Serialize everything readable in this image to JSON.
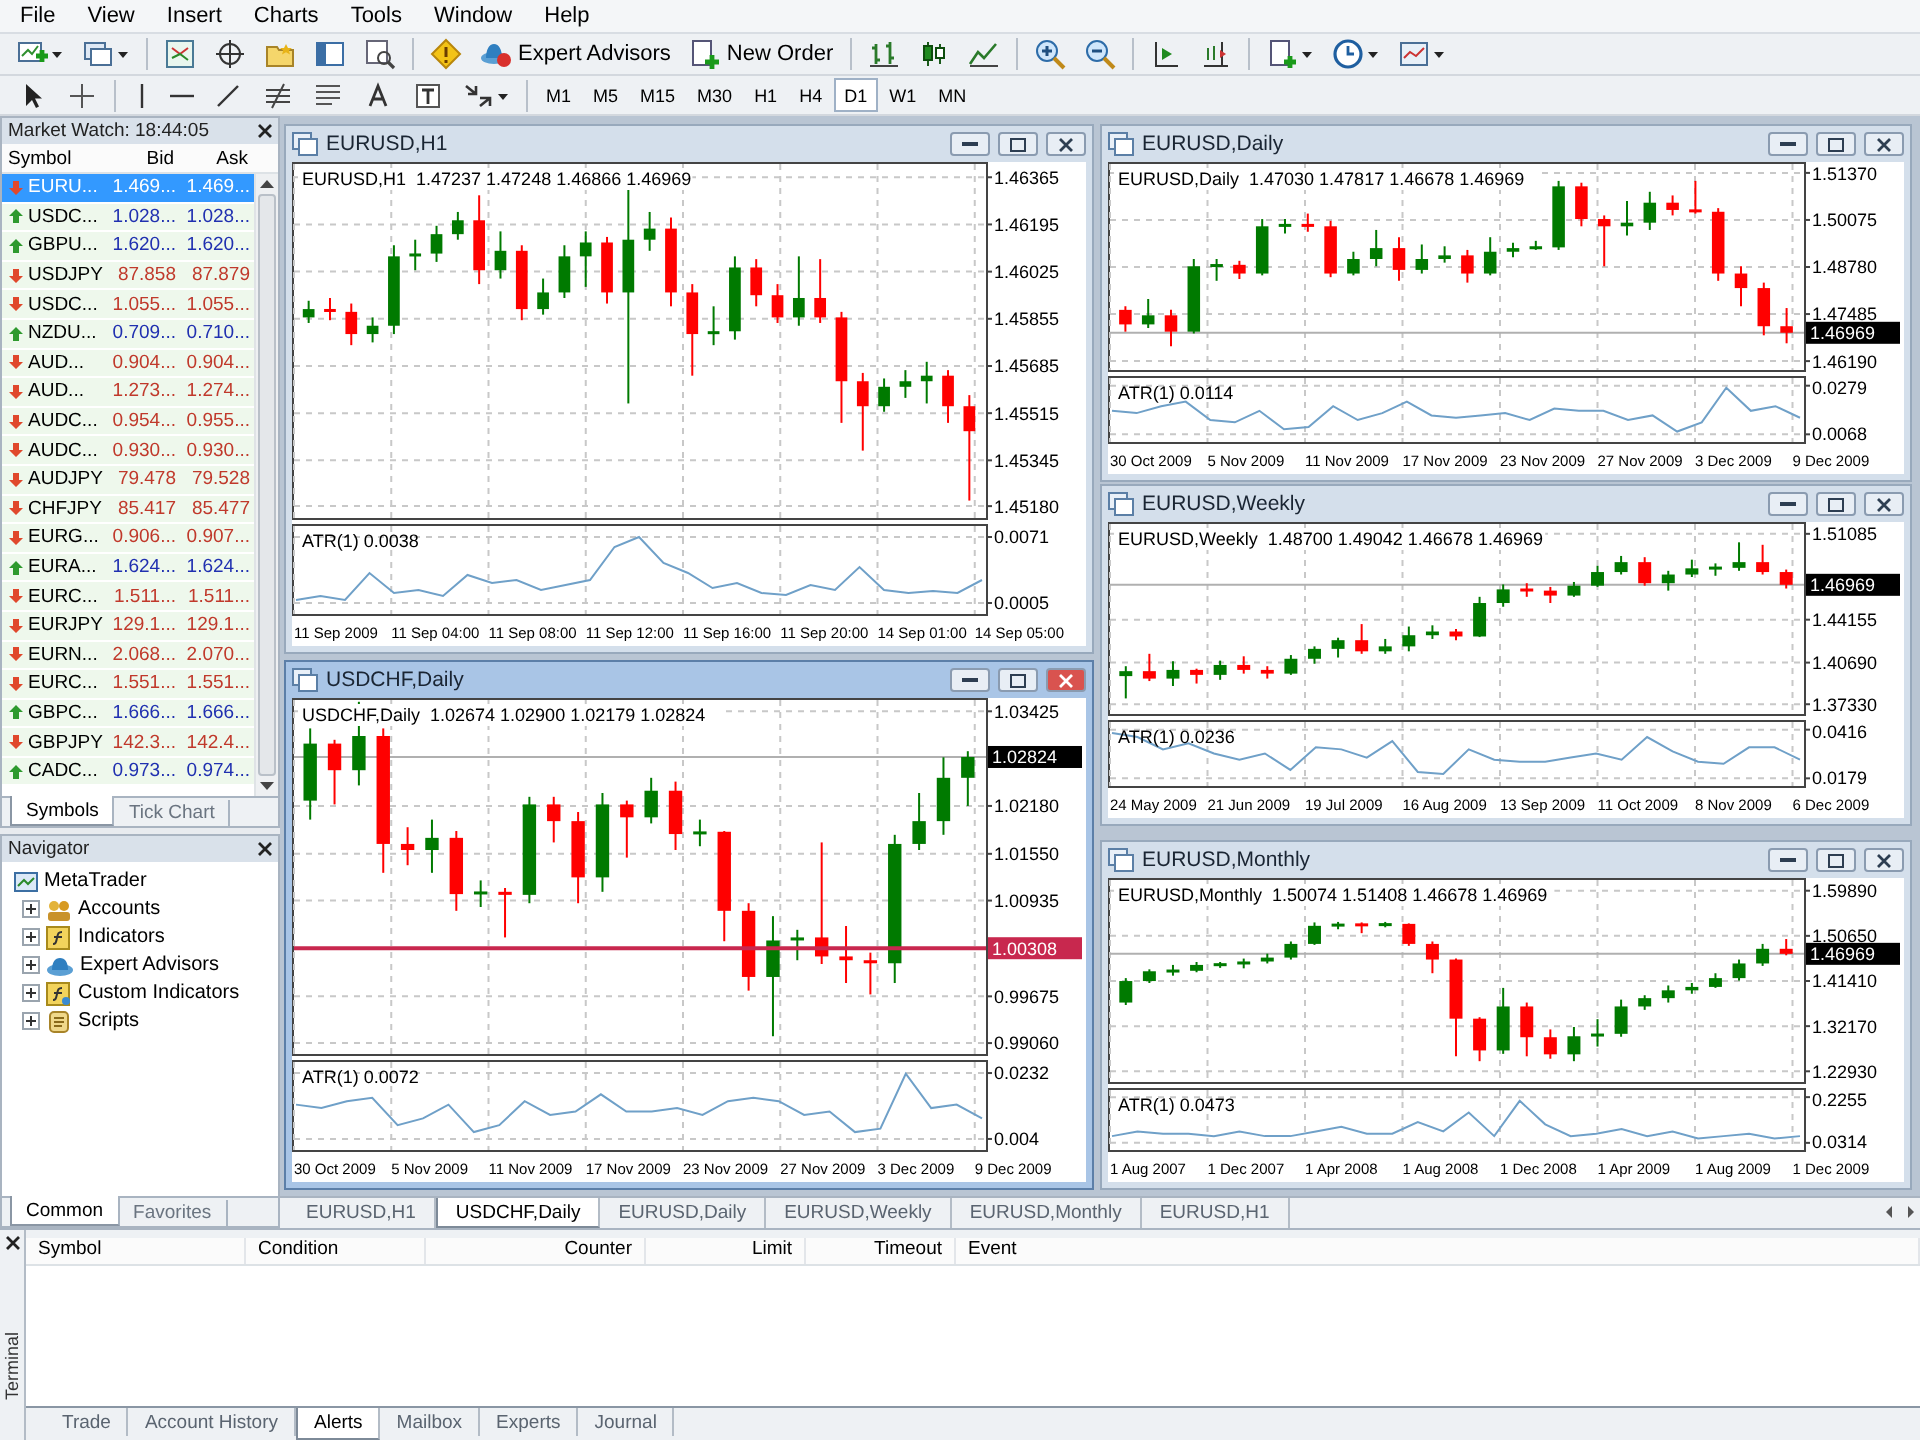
{
  "menu": [
    "File",
    "View",
    "Insert",
    "Charts",
    "Tools",
    "Window",
    "Help"
  ],
  "toolbar": {
    "expert_advisors": "Expert Advisors",
    "new_order": "New Order",
    "timeframes": [
      {
        "label": "M1",
        "selected": false
      },
      {
        "label": "M5",
        "selected": false
      },
      {
        "label": "M15",
        "selected": false
      },
      {
        "label": "M30",
        "selected": false
      },
      {
        "label": "H1",
        "selected": false
      },
      {
        "label": "H4",
        "selected": false
      },
      {
        "label": "D1",
        "selected": true
      },
      {
        "label": "W1",
        "selected": false
      },
      {
        "label": "MN",
        "selected": false
      }
    ]
  },
  "market_watch": {
    "title": "Market Watch: 18:44:05",
    "columns": [
      "Symbol",
      "Bid",
      "Ask"
    ],
    "rows": [
      {
        "symbol": "EURU...",
        "bid": "1.469...",
        "ask": "1.469...",
        "up": false,
        "selected": true
      },
      {
        "symbol": "USDC...",
        "bid": "1.028...",
        "ask": "1.028...",
        "up": true,
        "selected": false
      },
      {
        "symbol": "GBPU...",
        "bid": "1.620...",
        "ask": "1.620...",
        "up": true,
        "selected": false
      },
      {
        "symbol": "USDJPY",
        "bid": "87.858",
        "ask": "87.879",
        "up": false,
        "selected": false
      },
      {
        "symbol": "USDC...",
        "bid": "1.055...",
        "ask": "1.055...",
        "up": false,
        "selected": false
      },
      {
        "symbol": "NZDU...",
        "bid": "0.709...",
        "ask": "0.710...",
        "up": true,
        "selected": false
      },
      {
        "symbol": "AUD...",
        "bid": "0.904...",
        "ask": "0.904...",
        "up": false,
        "selected": false
      },
      {
        "symbol": "AUD...",
        "bid": "1.273...",
        "ask": "1.274...",
        "up": false,
        "selected": false
      },
      {
        "symbol": "AUDC...",
        "bid": "0.954...",
        "ask": "0.955...",
        "up": false,
        "selected": false
      },
      {
        "symbol": "AUDC...",
        "bid": "0.930...",
        "ask": "0.930...",
        "up": false,
        "selected": false
      },
      {
        "symbol": "AUDJPY",
        "bid": "79.478",
        "ask": "79.528",
        "up": false,
        "selected": false
      },
      {
        "symbol": "CHFJPY",
        "bid": "85.417",
        "ask": "85.477",
        "up": false,
        "selected": false
      },
      {
        "symbol": "EURG...",
        "bid": "0.906...",
        "ask": "0.907...",
        "up": false,
        "selected": false
      },
      {
        "symbol": "EURA...",
        "bid": "1.624...",
        "ask": "1.624...",
        "up": true,
        "selected": false
      },
      {
        "symbol": "EURC...",
        "bid": "1.511...",
        "ask": "1.511...",
        "up": false,
        "selected": false
      },
      {
        "symbol": "EURJPY",
        "bid": "129.1...",
        "ask": "129.1...",
        "up": false,
        "selected": false
      },
      {
        "symbol": "EURN...",
        "bid": "2.068...",
        "ask": "2.070...",
        "up": false,
        "selected": false
      },
      {
        "symbol": "EURC...",
        "bid": "1.551...",
        "ask": "1.551...",
        "up": false,
        "selected": false
      },
      {
        "symbol": "GBPC...",
        "bid": "1.666...",
        "ask": "1.666...",
        "up": true,
        "selected": false
      },
      {
        "symbol": "GBPJPY",
        "bid": "142.3...",
        "ask": "142.4...",
        "up": false,
        "selected": false
      },
      {
        "symbol": "CADC...",
        "bid": "0.973...",
        "ask": "0.974...",
        "up": true,
        "selected": false
      }
    ],
    "tabs": [
      {
        "label": "Symbols",
        "selected": true
      },
      {
        "label": "Tick Chart",
        "selected": false
      }
    ]
  },
  "navigator": {
    "title": "Navigator",
    "root": "MetaTrader",
    "children": [
      {
        "label": "Accounts",
        "kind": "accounts",
        "expanded": false
      },
      {
        "label": "Indicators",
        "kind": "indicators",
        "expanded": false
      },
      {
        "label": "Expert Advisors",
        "kind": "advisors",
        "expanded": false
      },
      {
        "label": "Custom Indicators",
        "kind": "custom",
        "expanded": false
      },
      {
        "label": "Scripts",
        "kind": "scripts",
        "expanded": false
      }
    ],
    "tabs": [
      {
        "label": "Common",
        "selected": true
      },
      {
        "label": "Favorites",
        "selected": false
      }
    ]
  },
  "charts": [
    {
      "title": "EURUSD,H1",
      "active": false,
      "price_pane": {
        "info": "EURUSD,H1  1.47237 1.47248 1.46866 1.46969",
        "chart_data": {
          "type": "candlestick",
          "ylim": [
            1.4513,
            1.4642
          ],
          "grid": true,
          "yticks": [
            {
              "value": 1.46365,
              "label": "1.46365"
            },
            {
              "value": 1.46195,
              "label": "1.46195"
            },
            {
              "value": 1.46025,
              "label": "1.46025"
            },
            {
              "value": 1.45855,
              "label": "1.45855"
            },
            {
              "value": 1.45685,
              "label": "1.45685"
            },
            {
              "value": 1.45515,
              "label": "1.45515"
            },
            {
              "value": 1.45345,
              "label": "1.45345"
            },
            {
              "value": 1.4518,
              "label": "1.45180"
            }
          ],
          "ohlc": [
            [
              1.4586,
              1.4592,
              1.4584,
              1.4589
            ],
            [
              1.4589,
              1.4593,
              1.4585,
              1.4588
            ],
            [
              1.4588,
              1.4591,
              1.4576,
              1.458
            ],
            [
              1.458,
              1.4586,
              1.4577,
              1.4583
            ],
            [
              1.4583,
              1.4612,
              1.458,
              1.4608
            ],
            [
              1.4608,
              1.4614,
              1.4603,
              1.4609
            ],
            [
              1.4609,
              1.4619,
              1.4606,
              1.4616
            ],
            [
              1.4616,
              1.4624,
              1.4614,
              1.4621
            ],
            [
              1.4621,
              1.463,
              1.4598,
              1.4603
            ],
            [
              1.4603,
              1.4617,
              1.46,
              1.461
            ],
            [
              1.461,
              1.4612,
              1.4585,
              1.4589
            ],
            [
              1.4589,
              1.46,
              1.4587,
              1.4595
            ],
            [
              1.4595,
              1.4612,
              1.4593,
              1.4608
            ],
            [
              1.4608,
              1.4617,
              1.4597,
              1.4613
            ],
            [
              1.4613,
              1.4615,
              1.4591,
              1.4595
            ],
            [
              1.4595,
              1.4633,
              1.4555,
              1.4614
            ],
            [
              1.4614,
              1.4624,
              1.461,
              1.4618
            ],
            [
              1.4618,
              1.4622,
              1.459,
              1.4595
            ],
            [
              1.4595,
              1.4598,
              1.4565,
              1.458
            ],
            [
              1.458,
              1.459,
              1.4576,
              1.4581
            ],
            [
              1.4581,
              1.4608,
              1.4578,
              1.4604
            ],
            [
              1.4604,
              1.4607,
              1.459,
              1.4594
            ],
            [
              1.4594,
              1.4598,
              1.4584,
              1.4586
            ],
            [
              1.4586,
              1.4608,
              1.4583,
              1.4593
            ],
            [
              1.4593,
              1.4607,
              1.4584,
              1.4586
            ],
            [
              1.4586,
              1.4588,
              1.4548,
              1.4563
            ],
            [
              1.4563,
              1.4566,
              1.4538,
              1.4554
            ],
            [
              1.4554,
              1.4564,
              1.4552,
              1.4561
            ],
            [
              1.4561,
              1.4567,
              1.4557,
              1.4563
            ],
            [
              1.4563,
              1.457,
              1.4555,
              1.4565
            ],
            [
              1.4565,
              1.4567,
              1.4548,
              1.4554
            ],
            [
              1.4554,
              1.4558,
              1.452,
              1.4545
            ]
          ]
        }
      },
      "indicator_pane": {
        "label": "ATR(1) 0.0038",
        "chart_data": {
          "type": "line",
          "ylim": [
            -0.0008,
            0.0084
          ],
          "grid": true,
          "yticks": [
            0.0071,
            0.0005
          ],
          "series": [
            {
              "color": "#6fa0c8",
              "values": [
                0.0008,
                0.0012,
                0.0008,
                0.0035,
                0.0015,
                0.0018,
                0.0012,
                0.0033,
                0.0025,
                0.0028,
                0.0018,
                0.0023,
                0.0028,
                0.0061,
                0.0071,
                0.0045,
                0.0035,
                0.002,
                0.0025,
                0.0015,
                0.0013,
                0.0023,
                0.0018,
                0.0041,
                0.0018,
                0.0015,
                0.0017,
                0.0015,
                0.0028
              ]
            }
          ]
        }
      },
      "times": [
        "11 Sep 2009",
        "11 Sep 04:00",
        "11 Sep 08:00",
        "11 Sep 12:00",
        "11 Sep 16:00",
        "11 Sep 20:00",
        "14 Sep 01:00",
        "14 Sep 05:00"
      ]
    },
    {
      "title": "EURUSD,Daily",
      "active": false,
      "price_pane": {
        "info": "EURUSD,Daily  1.47030 1.47817 1.46678 1.46969",
        "chart_data": {
          "type": "candlestick",
          "ylim": [
            1.4589,
            1.5167
          ],
          "grid": true,
          "yticks": [
            {
              "value": 1.5137,
              "label": "1.51370"
            },
            {
              "value": 1.50075,
              "label": "1.50075"
            },
            {
              "value": 1.4878,
              "label": "1.48780"
            },
            {
              "value": 1.47485,
              "label": "1.47485"
            },
            {
              "value": 1.4619,
              "label": "1.46190"
            }
          ],
          "ref_lines": [
            {
              "axis": "y",
              "value": 1.46969,
              "label": "1.46969",
              "color": "#b0b0b0"
            }
          ],
          "ohlc": [
            [
              1.476,
              1.477,
              1.47,
              1.472
            ],
            [
              1.472,
              1.479,
              1.471,
              1.4745
            ],
            [
              1.4745,
              1.476,
              1.466,
              1.47
            ],
            [
              1.47,
              1.49,
              1.4695,
              1.488
            ],
            [
              1.488,
              1.49,
              1.484,
              1.4884
            ],
            [
              1.4884,
              1.4895,
              1.4845,
              1.486
            ],
            [
              1.486,
              1.501,
              1.4855,
              1.499
            ],
            [
              1.499,
              1.501,
              1.497,
              1.4995
            ],
            [
              1.4995,
              1.5025,
              1.4975,
              1.499
            ],
            [
              1.499,
              1.5005,
              1.485,
              1.486
            ],
            [
              1.486,
              1.492,
              1.4855,
              1.49
            ],
            [
              1.49,
              1.498,
              1.488,
              1.493
            ],
            [
              1.493,
              1.496,
              1.484,
              1.487
            ],
            [
              1.487,
              1.494,
              1.486,
              1.49
            ],
            [
              1.49,
              1.4935,
              1.489,
              1.491
            ],
            [
              1.491,
              1.4925,
              1.4835,
              1.486
            ],
            [
              1.486,
              1.496,
              1.4855,
              1.492
            ],
            [
              1.492,
              1.4945,
              1.4905,
              1.493
            ],
            [
              1.493,
              1.495,
              1.4925,
              1.4932
            ],
            [
              1.4932,
              1.5115,
              1.4925,
              1.51
            ],
            [
              1.51,
              1.511,
              1.499,
              1.501
            ],
            [
              1.501,
              1.502,
              1.488,
              1.499
            ],
            [
              1.499,
              1.506,
              1.4965,
              1.5
            ],
            [
              1.5,
              1.5085,
              1.498,
              1.5055
            ],
            [
              1.5055,
              1.5075,
              1.502,
              1.5035
            ],
            [
              1.5035,
              1.5115,
              1.5025,
              1.503
            ],
            [
              1.503,
              1.504,
              1.484,
              1.486
            ],
            [
              1.486,
              1.488,
              1.477,
              1.482
            ],
            [
              1.482,
              1.4835,
              1.469,
              1.4715
            ],
            [
              1.4715,
              1.4765,
              1.4668,
              1.4697
            ]
          ]
        }
      },
      "indicator_pane": {
        "label": "ATR(1) 0.0114",
        "chart_data": {
          "type": "line",
          "ylim": [
            0.0026,
            0.0321
          ],
          "grid": true,
          "yticks": [
            0.0279,
            0.0068
          ],
          "series": [
            {
              "color": "#6fa0c8",
              "values": [
                0.017,
                0.016,
                0.019,
                0.021,
                0.013,
                0.012,
                0.017,
                0.009,
                0.01,
                0.019,
                0.013,
                0.016,
                0.021,
                0.015,
                0.014,
                0.015,
                0.016,
                0.013,
                0.018,
                0.017,
                0.017,
                0.013,
                0.015,
                0.008,
                0.012,
                0.027,
                0.017,
                0.019,
                0.014
              ]
            }
          ]
        }
      },
      "times": [
        "30 Oct 2009",
        "5 Nov 2009",
        "11 Nov 2009",
        "17 Nov 2009",
        "23 Nov 2009",
        "27 Nov 2009",
        "3 Dec 2009",
        "9 Dec 2009"
      ]
    },
    {
      "title": "EURUSD,Weekly",
      "active": false,
      "price_pane": {
        "info": "EURUSD,Weekly  1.48700 1.49042 1.46678 1.46969",
        "chart_data": {
          "type": "candlestick",
          "ylim": [
            1.3638,
            1.5204
          ],
          "grid": true,
          "yticks": [
            {
              "value": 1.51085,
              "label": "1.51085"
            },
            {
              "value": 1.44155,
              "label": "1.44155"
            },
            {
              "value": 1.4069,
              "label": "1.40690"
            },
            {
              "value": 1.3733,
              "label": "1.37330"
            }
          ],
          "ref_lines": [
            {
              "axis": "y",
              "value": 1.46969,
              "label": "1.46969",
              "color": "#b0b0b0"
            }
          ],
          "ohlc": [
            [
              1.396,
              1.404,
              1.378,
              1.4
            ],
            [
              1.4,
              1.414,
              1.392,
              1.394
            ],
            [
              1.394,
              1.408,
              1.388,
              1.401
            ],
            [
              1.401,
              1.402,
              1.39,
              1.397
            ],
            [
              1.397,
              1.4085,
              1.393,
              1.405
            ],
            [
              1.405,
              1.412,
              1.398,
              1.401
            ],
            [
              1.401,
              1.404,
              1.394,
              1.398
            ],
            [
              1.398,
              1.413,
              1.397,
              1.41
            ],
            [
              1.41,
              1.42,
              1.406,
              1.418
            ],
            [
              1.418,
              1.427,
              1.411,
              1.425
            ],
            [
              1.425,
              1.438,
              1.414,
              1.416
            ],
            [
              1.416,
              1.426,
              1.414,
              1.42
            ],
            [
              1.42,
              1.436,
              1.416,
              1.429
            ],
            [
              1.429,
              1.437,
              1.426,
              1.432
            ],
            [
              1.432,
              1.434,
              1.425,
              1.428
            ],
            [
              1.428,
              1.46,
              1.4275,
              1.455
            ],
            [
              1.455,
              1.47,
              1.452,
              1.466
            ],
            [
              1.466,
              1.471,
              1.46,
              1.465
            ],
            [
              1.465,
              1.468,
              1.455,
              1.461
            ],
            [
              1.461,
              1.472,
              1.46,
              1.469
            ],
            [
              1.469,
              1.485,
              1.468,
              1.48
            ],
            [
              1.48,
              1.493,
              1.478,
              1.488
            ],
            [
              1.488,
              1.492,
              1.469,
              1.471
            ],
            [
              1.471,
              1.481,
              1.465,
              1.478
            ],
            [
              1.478,
              1.49,
              1.476,
              1.483
            ],
            [
              1.483,
              1.487,
              1.477,
              1.4834
            ],
            [
              1.4834,
              1.504,
              1.481,
              1.488
            ],
            [
              1.488,
              1.502,
              1.478,
              1.48
            ],
            [
              1.48,
              1.482,
              1.4667,
              1.4697
            ]
          ]
        }
      },
      "indicator_pane": {
        "label": "ATR(1) 0.0236",
        "chart_data": {
          "type": "line",
          "ylim": [
            0.0132,
            0.0463
          ],
          "grid": true,
          "yticks": [
            0.0416,
            0.0179
          ],
          "series": [
            {
              "color": "#6fa0c8",
              "values": [
                0.04,
                0.038,
                0.032,
                0.035,
                0.03,
                0.027,
                0.03,
                0.022,
                0.033,
                0.032,
                0.028,
                0.036,
                0.021,
                0.02,
                0.032,
                0.027,
                0.026,
                0.026,
                0.028,
                0.03,
                0.027,
                0.038,
                0.031,
                0.026,
                0.025,
                0.033,
                0.033,
                0.027
              ]
            }
          ]
        }
      },
      "times": [
        "24 May 2009",
        "21 Jun 2009",
        "19 Jul 2009",
        "16 Aug 2009",
        "13 Sep 2009",
        "11 Oct 2009",
        "8 Nov 2009",
        "6 Dec 2009"
      ]
    },
    {
      "title": "USDCHF,Daily",
      "active": true,
      "price_pane": {
        "info": "USDCHF,Daily  1.02674 1.02900 1.02179 1.02824",
        "chart_data": {
          "type": "candlestick",
          "ylim": [
            0.9889,
            1.036
          ],
          "grid": true,
          "yticks": [
            {
              "value": 1.03425,
              "label": "1.03425"
            },
            {
              "value": 1.0218,
              "label": "1.02180"
            },
            {
              "value": 1.0155,
              "label": "1.01550"
            },
            {
              "value": 1.00935,
              "label": "1.00935"
            },
            {
              "value": 0.99675,
              "label": "0.99675"
            },
            {
              "value": 0.9906,
              "label": "0.99060"
            }
          ],
          "ref_lines": [
            {
              "axis": "y",
              "value": 1.02824,
              "label": "1.02824",
              "color": "#b0b0b0"
            },
            {
              "axis": "y",
              "value": 1.00308,
              "label": "1.00308",
              "color": "#c8284e"
            }
          ],
          "ohlc": [
            [
              1.0225,
              1.032,
              1.02,
              1.03
            ],
            [
              1.03,
              1.0305,
              1.022,
              1.0265
            ],
            [
              1.0265,
              1.0355,
              1.0245,
              1.031
            ],
            [
              1.031,
              1.032,
              1.013,
              1.0168
            ],
            [
              1.0168,
              1.019,
              1.014,
              1.016
            ],
            [
              1.016,
              1.02,
              1.013,
              1.0176
            ],
            [
              1.0176,
              1.0185,
              1.008,
              1.0102
            ],
            [
              1.0102,
              1.012,
              1.0085,
              1.0105
            ],
            [
              1.0105,
              1.011,
              1.0045,
              1.0101
            ],
            [
              1.0101,
              1.023,
              1.009,
              1.022
            ],
            [
              1.022,
              1.023,
              1.017,
              1.0198
            ],
            [
              1.0198,
              1.021,
              1.009,
              1.0124
            ],
            [
              1.0124,
              1.0235,
              1.0105,
              1.022
            ],
            [
              1.022,
              1.0225,
              1.015,
              1.0203
            ],
            [
              1.0203,
              1.0255,
              1.0195,
              1.0238
            ],
            [
              1.0238,
              1.025,
              1.016,
              1.0181
            ],
            [
              1.0181,
              1.02,
              1.0165,
              1.0184
            ],
            [
              1.0184,
              1.0185,
              1.004,
              1.008
            ],
            [
              1.008,
              1.009,
              0.9975,
              0.9993
            ],
            [
              0.9993,
              1.0073,
              0.9915,
              1.0041
            ],
            [
              1.0041,
              1.0055,
              1.0015,
              1.0045
            ],
            [
              1.0045,
              1.017,
              1.001,
              1.002
            ],
            [
              1.002,
              1.006,
              0.9985,
              1.0015
            ],
            [
              1.0015,
              1.0025,
              0.997,
              1.0011
            ],
            [
              1.0011,
              1.018,
              0.9985,
              1.0168
            ],
            [
              1.0168,
              1.0235,
              1.016,
              1.0198
            ],
            [
              1.0198,
              1.0282,
              1.018,
              1.0255
            ],
            [
              1.0255,
              1.029,
              1.0218,
              1.02824
            ]
          ]
        }
      },
      "indicator_pane": {
        "label": "ATR(1) 0.0072",
        "chart_data": {
          "type": "line",
          "ylim": [
            0.0002,
            0.027
          ],
          "grid": true,
          "yticks": [
            0.0232,
            0.004
          ],
          "series": [
            {
              "color": "#6fa0c8",
              "values": [
                0.014,
                0.013,
                0.015,
                0.016,
                0.008,
                0.01,
                0.014,
                0.006,
                0.008,
                0.015,
                0.011,
                0.012,
                0.017,
                0.012,
                0.012,
                0.013,
                0.011,
                0.015,
                0.016,
                0.015,
                0.011,
                0.012,
                0.006,
                0.007,
                0.023,
                0.013,
                0.014,
                0.01
              ]
            }
          ]
        }
      },
      "times": [
        "30 Oct 2009",
        "5 Nov 2009",
        "11 Nov 2009",
        "17 Nov 2009",
        "23 Nov 2009",
        "27 Nov 2009",
        "3 Dec 2009",
        "9 Dec 2009"
      ]
    },
    {
      "title": "EURUSD,Monthly",
      "active": false,
      "price_pane": {
        "info": "EURUSD,Monthly  1.50074 1.51408 1.46678 1.46969",
        "chart_data": {
          "type": "candlestick",
          "ylim": [
            1.2033,
            1.6249
          ],
          "grid": true,
          "yticks": [
            {
              "value": 1.5989,
              "label": "1.59890"
            },
            {
              "value": 1.5065,
              "label": "1.50650"
            },
            {
              "value": 1.4141,
              "label": "1.41410"
            },
            {
              "value": 1.3217,
              "label": "1.32170"
            },
            {
              "value": 1.2293,
              "label": "1.22930"
            }
          ],
          "ref_lines": [
            {
              "axis": "y",
              "value": 1.46969,
              "label": "1.46969",
              "color": "#b0b0b0"
            }
          ],
          "ohlc": [
            [
              1.37,
              1.42,
              1.365,
              1.414
            ],
            [
              1.414,
              1.438,
              1.41,
              1.434
            ],
            [
              1.434,
              1.447,
              1.425,
              1.435
            ],
            [
              1.435,
              1.453,
              1.432,
              1.447
            ],
            [
              1.447,
              1.453,
              1.441,
              1.448
            ],
            [
              1.448,
              1.46,
              1.44,
              1.454
            ],
            [
              1.454,
              1.47,
              1.45,
              1.462
            ],
            [
              1.462,
              1.495,
              1.458,
              1.49
            ],
            [
              1.49,
              1.534,
              1.488,
              1.527
            ],
            [
              1.527,
              1.535,
              1.52,
              1.53
            ],
            [
              1.53,
              1.534,
              1.512,
              1.528
            ],
            [
              1.528,
              1.535,
              1.524,
              1.531
            ],
            [
              1.531,
              1.532,
              1.486,
              1.49
            ],
            [
              1.49,
              1.495,
              1.43,
              1.458
            ],
            [
              1.458,
              1.46,
              1.26,
              1.337
            ],
            [
              1.337,
              1.34,
              1.25,
              1.272
            ],
            [
              1.272,
              1.4,
              1.265,
              1.362
            ],
            [
              1.362,
              1.37,
              1.26,
              1.299
            ],
            [
              1.299,
              1.315,
              1.255,
              1.264
            ],
            [
              1.264,
              1.32,
              1.25,
              1.301
            ],
            [
              1.301,
              1.336,
              1.28,
              1.306
            ],
            [
              1.306,
              1.376,
              1.3,
              1.362
            ],
            [
              1.362,
              1.385,
              1.355,
              1.379
            ],
            [
              1.379,
              1.405,
              1.37,
              1.395
            ],
            [
              1.395,
              1.41,
              1.388,
              1.402
            ],
            [
              1.402,
              1.43,
              1.4,
              1.42
            ],
            [
              1.42,
              1.458,
              1.415,
              1.45
            ],
            [
              1.45,
              1.49,
              1.445,
              1.48
            ],
            [
              1.48,
              1.5,
              1.4667,
              1.4697
            ]
          ]
        }
      },
      "indicator_pane": {
        "label": "ATR(1) 0.0473",
        "chart_data": {
          "type": "line",
          "ylim": [
            -0.0074,
            0.2643
          ],
          "grid": true,
          "yticks": [
            0.2255,
            0.0314
          ],
          "series": [
            {
              "color": "#6fa0c8",
              "values": [
                0.06,
                0.08,
                0.07,
                0.07,
                0.06,
                0.08,
                0.06,
                0.06,
                0.08,
                0.1,
                0.07,
                0.07,
                0.12,
                0.08,
                0.16,
                0.06,
                0.21,
                0.11,
                0.06,
                0.07,
                0.09,
                0.06,
                0.08,
                0.05,
                0.06,
                0.07,
                0.05,
                0.06
              ]
            }
          ]
        }
      },
      "times": [
        "1 Aug 2007",
        "1 Dec 2007",
        "1 Apr 2008",
        "1 Aug 2008",
        "1 Dec 2008",
        "1 Apr 2009",
        "1 Aug 2009",
        "1 Dec 2009"
      ]
    }
  ],
  "chart_tabs": [
    {
      "label": "EURUSD,H1",
      "selected": false
    },
    {
      "label": "USDCHF,Daily",
      "selected": true
    },
    {
      "label": "EURUSD,Daily",
      "selected": false
    },
    {
      "label": "EURUSD,Weekly",
      "selected": false
    },
    {
      "label": "EURUSD,Monthly",
      "selected": false
    },
    {
      "label": "EURUSD,H1",
      "selected": false
    }
  ],
  "terminal": {
    "label": "Terminal",
    "columns": [
      "Symbol",
      "Condition",
      "Counter",
      "Limit",
      "Timeout",
      "Event"
    ],
    "tabs": [
      {
        "label": "Trade",
        "selected": false
      },
      {
        "label": "Account History",
        "selected": false
      },
      {
        "label": "Alerts",
        "selected": true
      },
      {
        "label": "Mailbox",
        "selected": false
      },
      {
        "label": "Experts",
        "selected": false
      },
      {
        "label": "Journal",
        "selected": false
      }
    ]
  }
}
